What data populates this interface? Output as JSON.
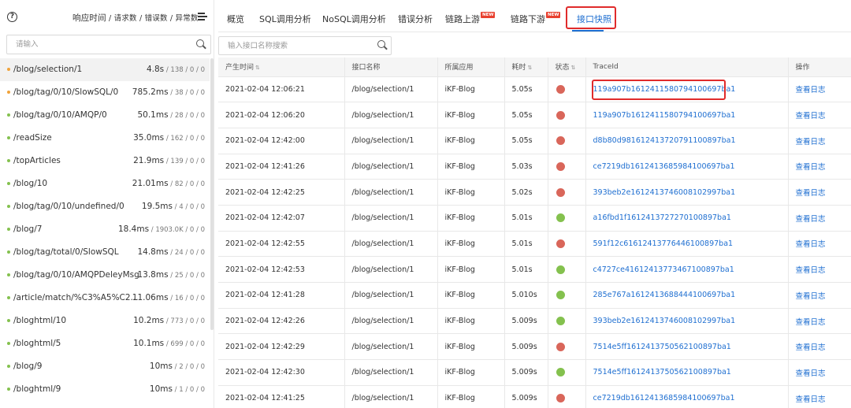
{
  "colors": {
    "accent": "#1f6fd1",
    "highlight": "#e02b2b",
    "status_error": "#d9665a",
    "status_ok": "#84c14e",
    "dot_warn": "#f0a33b",
    "dot_ok": "#84c14e"
  },
  "sidebar": {
    "help_icon": "?",
    "sort_label": "响应时间",
    "sort_options": " / 请求数 / 错误数 / 异常数",
    "search_placeholder": "请输入",
    "items": [
      {
        "name": "/blog/selection/1",
        "time": "4.8s",
        "rest": " / 138 / 0 / 0",
        "dot": "warn",
        "active": true
      },
      {
        "name": "/blog/tag/0/10/SlowSQL/0",
        "time": "785.2ms",
        "rest": " / 38 / 0 / 0",
        "dot": "warn"
      },
      {
        "name": "/blog/tag/0/10/AMQP/0",
        "time": "50.1ms",
        "rest": " / 28 / 0 / 0",
        "dot": "ok"
      },
      {
        "name": "/readSize",
        "time": "35.0ms",
        "rest": " / 162 / 0 / 0",
        "dot": "ok"
      },
      {
        "name": "/topArticles",
        "time": "21.9ms",
        "rest": " / 139 / 0 / 0",
        "dot": "ok"
      },
      {
        "name": "/blog/10",
        "time": "21.01ms",
        "rest": " / 82 / 0 / 0",
        "dot": "ok"
      },
      {
        "name": "/blog/tag/0/10/undefined/0",
        "time": "19.5ms",
        "rest": " / 4 / 0 / 0",
        "dot": "ok"
      },
      {
        "name": "/blog/7",
        "time": "18.4ms",
        "rest": " / 1903.0K / 0 / 0",
        "dot": "ok"
      },
      {
        "name": "/blog/tag/total/0/SlowSQL",
        "time": "14.8ms",
        "rest": " / 24 / 0 / 0",
        "dot": "ok"
      },
      {
        "name": "/blog/tag/0/10/AMQPDeleyMsg/0",
        "time": "13.8ms",
        "rest": " / 25 / 0 / 0",
        "dot": "ok"
      },
      {
        "name": "/article/match/%C3%A5%C2...",
        "time": "11.06ms",
        "rest": " / 16 / 0 / 0",
        "dot": "ok"
      },
      {
        "name": "/bloghtml/10",
        "time": "10.2ms",
        "rest": " / 773 / 0 / 0",
        "dot": "ok"
      },
      {
        "name": "/bloghtml/5",
        "time": "10.1ms",
        "rest": " / 699 / 0 / 0",
        "dot": "ok"
      },
      {
        "name": "/blog/9",
        "time": "10ms",
        "rest": " / 2 / 0 / 0",
        "dot": "ok"
      },
      {
        "name": "/bloghtml/9",
        "time": "10ms",
        "rest": " / 1 / 0 / 0",
        "dot": "ok"
      }
    ]
  },
  "tabs": [
    {
      "label": "概览"
    },
    {
      "label": "SQL调用分析"
    },
    {
      "label": "NoSQL调用分析"
    },
    {
      "label": "错误分析"
    },
    {
      "label": "链路上游",
      "badge": "NEW"
    },
    {
      "label": "链路下游",
      "badge": "NEW"
    },
    {
      "label": "接口快照",
      "active": true
    }
  ],
  "main": {
    "search_placeholder": "输入接口名称搜索",
    "columns": [
      "产生时间",
      "接口名称",
      "所属应用",
      "耗时",
      "状态",
      "TraceId",
      "操作"
    ],
    "sort_icon": "⇅",
    "rows": [
      {
        "time": "2021-02-04 12:06:21",
        "api": "/blog/selection/1",
        "app": "iKF-Blog",
        "cost": "5.05s",
        "status": "error",
        "trace": "119a907b1612411580794100697ba1",
        "action": "查看日志"
      },
      {
        "time": "2021-02-04 12:06:20",
        "api": "/blog/selection/1",
        "app": "iKF-Blog",
        "cost": "5.05s",
        "status": "error",
        "trace": "119a907b1612411580794100697ba1",
        "action": "查看日志"
      },
      {
        "time": "2021-02-04 12:42:00",
        "api": "/blog/selection/1",
        "app": "iKF-Blog",
        "cost": "5.05s",
        "status": "error",
        "trace": "d8b80d981612413720791100897ba1",
        "action": "查看日志"
      },
      {
        "time": "2021-02-04 12:41:26",
        "api": "/blog/selection/1",
        "app": "iKF-Blog",
        "cost": "5.03s",
        "status": "error",
        "trace": "ce7219db1612413685984100697ba1",
        "action": "查看日志"
      },
      {
        "time": "2021-02-04 12:42:25",
        "api": "/blog/selection/1",
        "app": "iKF-Blog",
        "cost": "5.02s",
        "status": "error",
        "trace": "393beb2e1612413746008102997ba1",
        "action": "查看日志"
      },
      {
        "time": "2021-02-04 12:42:07",
        "api": "/blog/selection/1",
        "app": "iKF-Blog",
        "cost": "5.01s",
        "status": "ok",
        "trace": "a16fbd1f1612413727270100897ba1",
        "action": "查看日志"
      },
      {
        "time": "2021-02-04 12:42:55",
        "api": "/blog/selection/1",
        "app": "iKF-Blog",
        "cost": "5.01s",
        "status": "error",
        "trace": "591f12c61612413776446100897ba1",
        "action": "查看日志"
      },
      {
        "time": "2021-02-04 12:42:53",
        "api": "/blog/selection/1",
        "app": "iKF-Blog",
        "cost": "5.01s",
        "status": "ok",
        "trace": "c4727ce41612413773467100897ba1",
        "action": "查看日志"
      },
      {
        "time": "2021-02-04 12:41:28",
        "api": "/blog/selection/1",
        "app": "iKF-Blog",
        "cost": "5.010s",
        "status": "ok",
        "trace": "285e767a1612413688444100697ba1",
        "action": "查看日志"
      },
      {
        "time": "2021-02-04 12:42:26",
        "api": "/blog/selection/1",
        "app": "iKF-Blog",
        "cost": "5.009s",
        "status": "ok",
        "trace": "393beb2e1612413746008102997ba1",
        "action": "查看日志"
      },
      {
        "time": "2021-02-04 12:42:29",
        "api": "/blog/selection/1",
        "app": "iKF-Blog",
        "cost": "5.009s",
        "status": "error",
        "trace": "7514e5ff1612413750562100897ba1",
        "action": "查看日志"
      },
      {
        "time": "2021-02-04 12:42:30",
        "api": "/blog/selection/1",
        "app": "iKF-Blog",
        "cost": "5.009s",
        "status": "ok",
        "trace": "7514e5ff1612413750562100897ba1",
        "action": "查看日志"
      },
      {
        "time": "2021-02-04 12:41:25",
        "api": "/blog/selection/1",
        "app": "iKF-Blog",
        "cost": "5.009s",
        "status": "error",
        "trace": "ce7219db1612413685984100697ba1",
        "action": "查看日志"
      }
    ]
  }
}
